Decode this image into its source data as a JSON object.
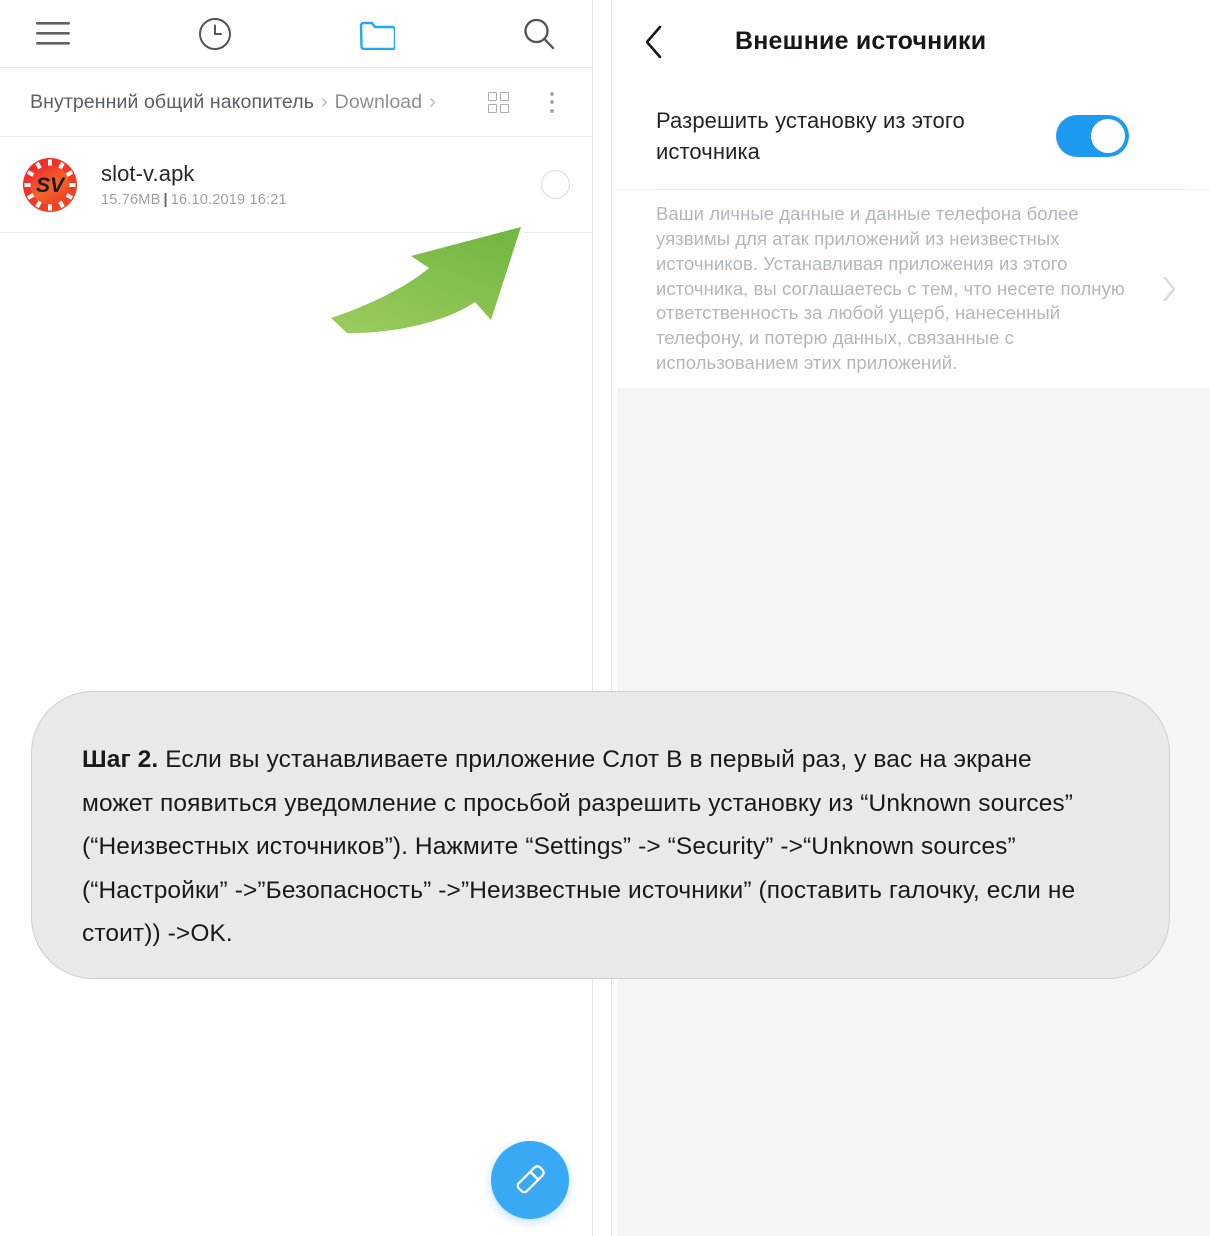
{
  "file_manager": {
    "toolbar": [
      {
        "name": "menu-icon",
        "label": "Меню"
      },
      {
        "name": "recent-icon",
        "label": "Недавние"
      },
      {
        "name": "folder-icon",
        "label": "Папки"
      },
      {
        "name": "search-icon",
        "label": "Поиск"
      }
    ],
    "breadcrumb": {
      "root": "Внутренний общий накопитель",
      "separator": "›",
      "folder": "Download",
      "grid_view_label": "Вид сеткой",
      "overflow_label": "Ещё"
    },
    "files": [
      {
        "name": "slot-v.apk",
        "size": "15.76MB",
        "divider": "|",
        "date": "16.10.2019 16:21",
        "icon_label": "SV",
        "selected": false
      }
    ],
    "fab": {
      "name": "cleanup-fab",
      "label": "Очистка"
    },
    "arrow": {
      "name": "green-arrow-annotation"
    }
  },
  "settings": {
    "back_label": "Назад",
    "title": "Внешние источники",
    "toggle": {
      "label": "Разрешить установку из этого источника",
      "state": "on",
      "color": "#1c9bf0"
    },
    "description": "Ваши личные данные и данные телефона более уязвимы для атак приложений из неизвестных источников. Устанавливая приложения из этого источника, вы соглашаетесь с тем, что несете полную ответственность за любой ущерб, нанесенный телефону, и потерю данных, связанные с использованием этих приложений.",
    "chevron_label": "Подробнее"
  },
  "callout": {
    "step_label": "Шаг 2.",
    "text": " Если вы устанавливаете приложение Слот В в первый раз, у вас на экране может появиться уведомление с просьбой разрешить установку из “Unknown sources” (“Неизвестных источников”). Нажмите “Settings” -> “Security” ->“Unknown sources” (“Настройки” ->”Безопасность” ->”Неизвестные источники” (поставить галочку, если не стоит)) ->OK."
  },
  "colors": {
    "accent_blue": "#1c9bf0",
    "fab_blue": "#3aa9f5",
    "arrow_green": "#8cc552",
    "callout_bg": "#e9e9e9",
    "panel_bg": "#f5f5f5"
  }
}
